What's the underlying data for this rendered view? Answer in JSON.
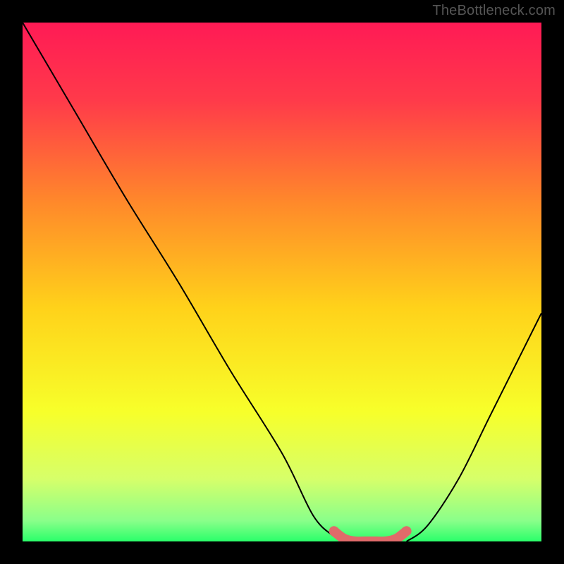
{
  "watermark": "TheBottleneck.com",
  "chart_data": {
    "type": "line",
    "title": "",
    "xlabel": "",
    "ylabel": "",
    "xlim": [
      0,
      100
    ],
    "ylim": [
      0,
      100
    ],
    "series": [
      {
        "name": "curve-left",
        "x": [
          0,
          10,
          20,
          30,
          40,
          50,
          56,
          60,
          62
        ],
        "y": [
          100,
          83,
          66,
          50,
          33,
          17,
          5,
          1,
          0
        ]
      },
      {
        "name": "curve-right",
        "x": [
          74,
          78,
          84,
          90,
          96,
          100
        ],
        "y": [
          0,
          3,
          12,
          24,
          36,
          44
        ]
      },
      {
        "name": "trough-highlight",
        "x": [
          60,
          62,
          64,
          66,
          68,
          70,
          72,
          74
        ],
        "y": [
          2,
          0.5,
          0,
          0,
          0,
          0,
          0.5,
          2
        ]
      }
    ],
    "gradient_stops": [
      {
        "offset": 0.0,
        "color": "#ff1a55"
      },
      {
        "offset": 0.15,
        "color": "#ff3a4a"
      },
      {
        "offset": 0.35,
        "color": "#ff8a2a"
      },
      {
        "offset": 0.55,
        "color": "#ffd21a"
      },
      {
        "offset": 0.75,
        "color": "#f7ff2a"
      },
      {
        "offset": 0.88,
        "color": "#d6ff6a"
      },
      {
        "offset": 0.96,
        "color": "#8aff8a"
      },
      {
        "offset": 1.0,
        "color": "#2aff6a"
      }
    ],
    "highlight_color": "#e06a6a",
    "curve_color": "#000000"
  }
}
